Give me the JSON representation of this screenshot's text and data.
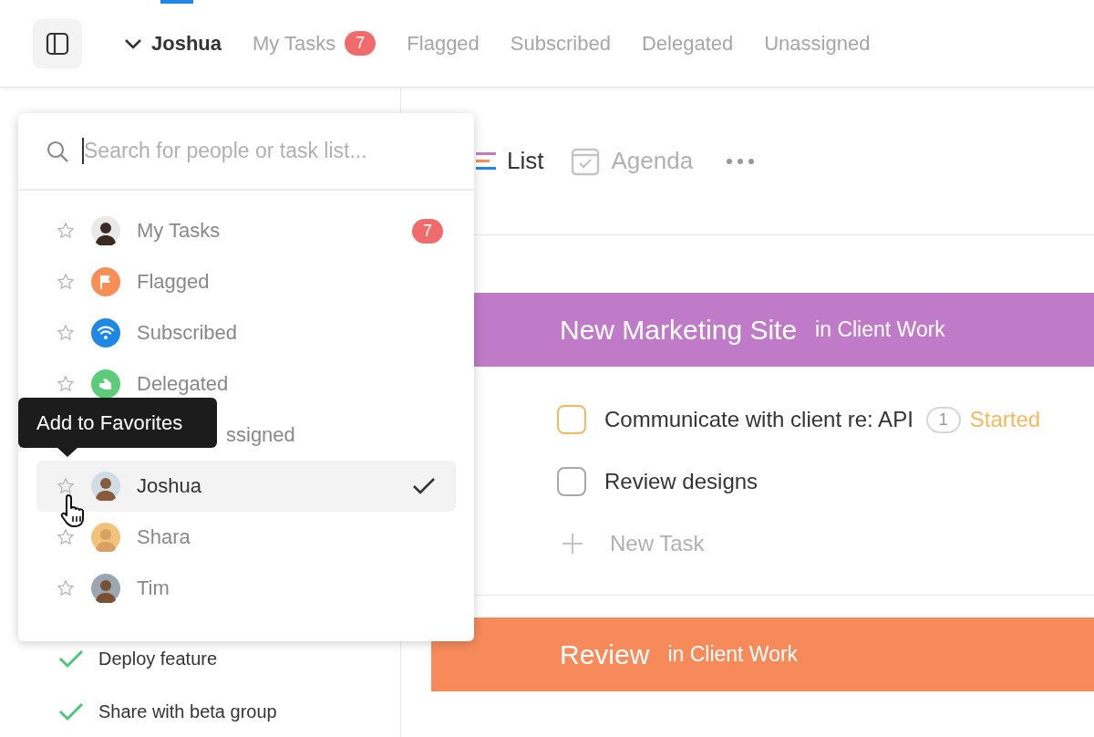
{
  "header": {
    "tabs": [
      {
        "label": "Joshua",
        "selected": true,
        "kind": "person-menu"
      },
      {
        "label": "My Tasks",
        "selected": false,
        "kind": "list",
        "badge": "7"
      },
      {
        "label": "Flagged",
        "selected": false,
        "kind": "list"
      },
      {
        "label": "Subscribed",
        "selected": false,
        "kind": "list"
      },
      {
        "label": "Delegated",
        "selected": false,
        "kind": "list"
      },
      {
        "label": "Unassigned",
        "selected": false,
        "kind": "list"
      }
    ]
  },
  "sidebar": {
    "tasks": [
      {
        "label": "Deploy feature",
        "done": true
      },
      {
        "label": "Share with beta group",
        "done": true
      }
    ]
  },
  "views": {
    "tabs": [
      {
        "label": "List",
        "selected": true,
        "kind": "list"
      },
      {
        "label": "Agenda",
        "selected": false,
        "kind": "agenda"
      }
    ]
  },
  "sections": [
    {
      "title": "New Marketing Site",
      "subtitle": "in Client Work",
      "kind": "purple",
      "tasks": [
        {
          "label": "Communicate with client re: API",
          "kind": "started",
          "checked": false,
          "comments": "1",
          "status_text": "Started"
        },
        {
          "label": "Review designs",
          "kind": "open",
          "checked": false
        }
      ],
      "new_task": "New Task"
    },
    {
      "title": "Review",
      "subtitle": "in Client Work",
      "kind": "orange"
    }
  ],
  "picker": {
    "search": {
      "placeholder": "Search for people or task list..."
    },
    "items": [
      {
        "label": "My Tasks",
        "kind": "person",
        "badge": "7",
        "selected": false
      },
      {
        "label": "Flagged",
        "kind": "flag",
        "selected": false
      },
      {
        "label": "Subscribed",
        "kind": "wifi",
        "selected": false
      },
      {
        "label": "Delegated",
        "kind": "delegate",
        "selected": false
      },
      {
        "label": "ssigned",
        "kind": "covered",
        "selected": false
      },
      {
        "label": "Joshua",
        "kind": "person",
        "selected": true
      },
      {
        "label": "Shara",
        "kind": "person",
        "selected": false
      },
      {
        "label": "Tim",
        "kind": "person",
        "selected": false
      }
    ],
    "tooltip": "Add to Favorites"
  }
}
